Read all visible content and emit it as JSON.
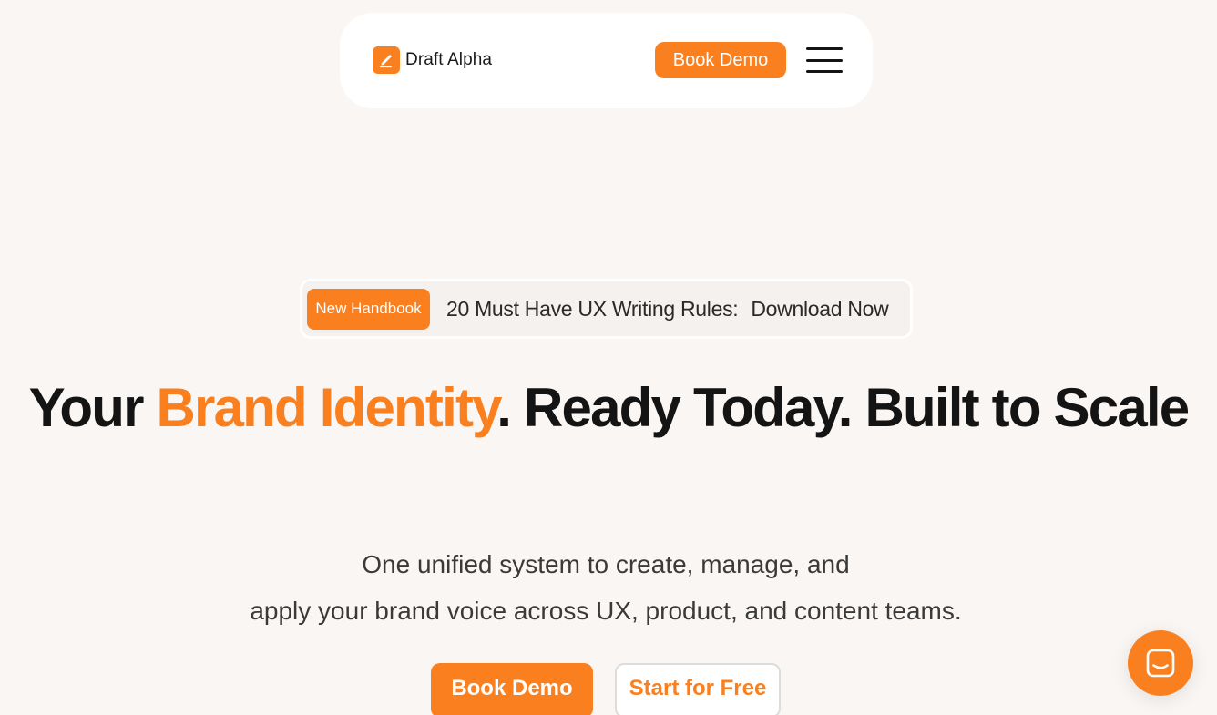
{
  "brand": {
    "name": "Draft Alpha",
    "accent_color": "#f97f1f"
  },
  "header": {
    "cta_label": "Book Demo",
    "menu_icon": "hamburger-menu-icon"
  },
  "announcement": {
    "badge": "New Handbook",
    "text": "20 Must Have UX Writing Rules:",
    "link": "Download Now"
  },
  "hero": {
    "title_pre": "Your ",
    "title_accent": "Brand Identity",
    "title_post": ". Ready Today. Built to Scale",
    "subtitle_line1": "One unified system to create, manage, and",
    "subtitle_line2": "apply your brand voice across UX, product, and content teams.",
    "primary_cta": "Book Demo",
    "secondary_cta": "Start for Free"
  },
  "chat": {
    "icon": "chat-icon"
  }
}
